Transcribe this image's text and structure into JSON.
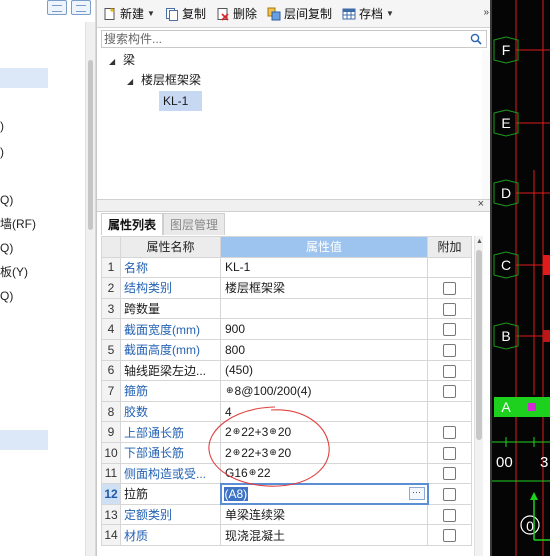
{
  "left_panel": {
    "rows": [
      {
        "text": ")",
        "selected": false
      },
      {
        "text": ")",
        "selected": false
      },
      {
        "text": "Q)",
        "selected": false
      },
      {
        "text": "墙(RF)",
        "selected": false
      },
      {
        "text": "Q)",
        "selected": false
      },
      {
        "text": "板(Y)",
        "selected": false
      },
      {
        "text": "Q)",
        "selected": false
      }
    ]
  },
  "toolbar": {
    "new_label": "新建",
    "copy_label": "复制",
    "delete_label": "删除",
    "floor_copy_label": "层间复制",
    "save_label": "存档",
    "more_label": "»"
  },
  "search": {
    "placeholder": "搜索构件..."
  },
  "component_tree": {
    "root": "梁",
    "child": "楼层框架梁",
    "leaf": "KL-1"
  },
  "panel_tabs": {
    "close_label": "×",
    "tabs": [
      "属性列表",
      "图层管理"
    ]
  },
  "property_table": {
    "headers": {
      "name": "属性名称",
      "value": "属性值",
      "extra": "附加"
    },
    "rows": [
      {
        "num": "1",
        "name": "名称",
        "value": "KL-1",
        "blue": true,
        "checkbox": false
      },
      {
        "num": "2",
        "name": "结构类别",
        "value": "楼层框架梁",
        "blue": true,
        "checkbox": true
      },
      {
        "num": "3",
        "name": "跨数量",
        "value": "",
        "blue": false,
        "checkbox": true
      },
      {
        "num": "4",
        "name": "截面宽度(mm)",
        "value": "900",
        "blue": true,
        "checkbox": true
      },
      {
        "num": "5",
        "name": "截面高度(mm)",
        "value": "800",
        "blue": true,
        "checkbox": true
      },
      {
        "num": "6",
        "name": "轴线距梁左边...",
        "value": "(450)",
        "blue": false,
        "checkbox": true
      },
      {
        "num": "7",
        "name": "箍筋",
        "value": "8@100/200(4)",
        "rebar_prefix": true,
        "blue": true,
        "checkbox": true
      },
      {
        "num": "8",
        "name": "胶数",
        "value": "4",
        "blue": true,
        "checkbox": false
      },
      {
        "num": "9",
        "name": "上部通长筋",
        "value_parts": [
          "2",
          "22+3",
          "20"
        ],
        "blue": true,
        "checkbox": true
      },
      {
        "num": "10",
        "name": "下部通长筋",
        "value_parts": [
          "2",
          "22+3",
          "20"
        ],
        "blue": true,
        "checkbox": true
      },
      {
        "num": "11",
        "name": "侧面构造或受...",
        "value_parts": [
          "G16",
          "22"
        ],
        "blue": true,
        "checkbox": true
      },
      {
        "num": "12",
        "name": "拉筋",
        "value": "(A8)",
        "blue": false,
        "checkbox": true,
        "editing": true,
        "current": true
      },
      {
        "num": "13",
        "name": "定额类别",
        "value": "单梁连续梁",
        "blue": true,
        "checkbox": true
      },
      {
        "num": "14",
        "name": "材质",
        "value": "现浇混凝土",
        "blue": true,
        "checkbox": true
      }
    ],
    "rebar_symbol": "⊕"
  },
  "cad_view": {
    "axes": [
      {
        "label": "F",
        "highlight": false
      },
      {
        "label": "E",
        "highlight": false
      },
      {
        "label": "D",
        "highlight": false
      },
      {
        "label": "C",
        "highlight": false
      },
      {
        "label": "B",
        "highlight": false
      },
      {
        "label": "A",
        "highlight": true
      }
    ],
    "dimension_text": "00",
    "dimension_text_2": "3",
    "origin_label": "0",
    "colors": {
      "background": "#050505",
      "grid": "#e01b1b",
      "axis_green": "#1fd11f",
      "circle": "#1c9c1c"
    }
  },
  "colors": {
    "header_value_blue": "#9cc4ee",
    "name_blue": "#2462b3",
    "annotation_red": "#e04040"
  }
}
